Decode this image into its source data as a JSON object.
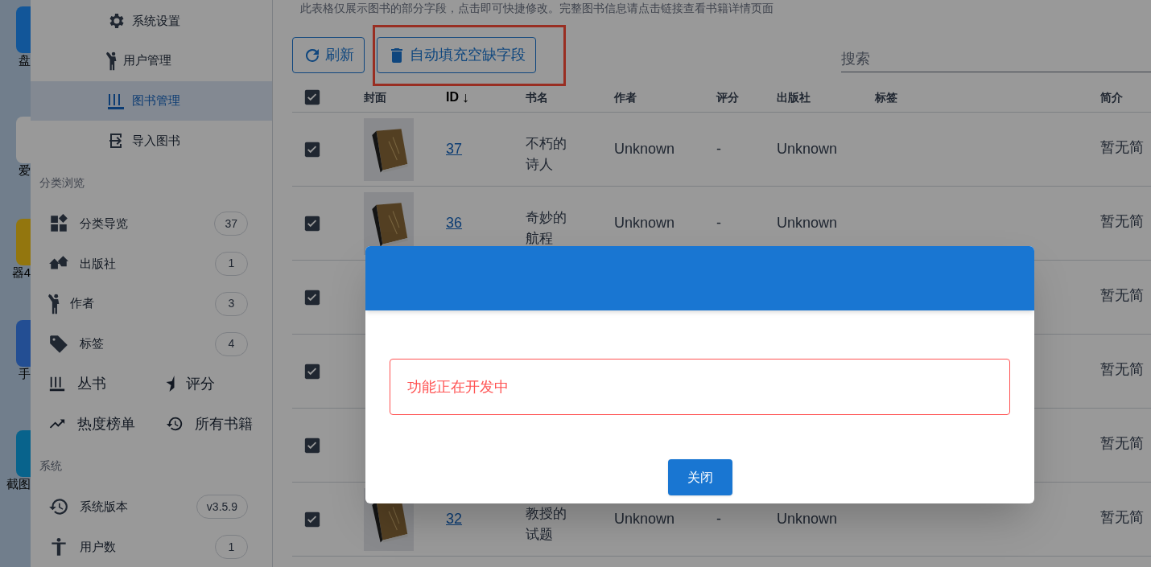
{
  "desktop_icons": [
    {
      "label": "盘"
    },
    {
      "label": "爱"
    },
    {
      "label": "器4"
    },
    {
      "label": "手"
    },
    {
      "label": "截图"
    }
  ],
  "sidebar": {
    "menu": [
      {
        "label": "系统设置",
        "selected": false
      },
      {
        "label": "用户管理",
        "selected": false
      },
      {
        "label": "图书管理",
        "selected": true
      },
      {
        "label": "导入图书",
        "selected": false
      }
    ],
    "browse_title": "分类浏览",
    "browse_items": [
      {
        "label": "分类导览",
        "count": "37"
      },
      {
        "label": "出版社",
        "count": "1"
      },
      {
        "label": "作者",
        "count": "3"
      },
      {
        "label": "标签",
        "count": "4"
      }
    ],
    "quick_links": [
      {
        "label": "丛书"
      },
      {
        "label": "评分"
      },
      {
        "label": "热度榜单"
      },
      {
        "label": "所有书籍"
      }
    ],
    "system_title": "系统",
    "system_items": [
      {
        "label": "系统版本",
        "count": "v3.5.9"
      },
      {
        "label": "用户数",
        "count": "1"
      }
    ]
  },
  "main": {
    "description": "此表格仅展示图书的部分字段，点击即可快捷修改。完整图书信息请点击链接查看书籍详情页面",
    "buttons": [
      {
        "label": "刷新",
        "highlighted": false
      },
      {
        "label": "自动填充空缺字段",
        "highlighted": true
      }
    ],
    "search": {
      "placeholder": "搜索"
    },
    "table": {
      "select_all": {
        "checked": true
      },
      "columns": [
        "封面",
        "ID",
        "书名",
        "作者",
        "评分",
        "出版社",
        "标签",
        "简介"
      ],
      "sort_indicator": "↓",
      "rows": [
        {
          "checked": true,
          "id": "37",
          "title": "不朽的诗人",
          "author": "Unknown",
          "rating": "-",
          "publisher": "Unknown",
          "intro": "暂无简"
        },
        {
          "checked": true,
          "id": "36",
          "title": "奇妙的航程",
          "author": "Unknown",
          "rating": "-",
          "publisher": "Unknown",
          "intro": "暂无简"
        },
        {
          "checked": true,
          "intro": "暂无简"
        },
        {
          "checked": true,
          "intro": "暂无简"
        },
        {
          "checked": true,
          "intro": "暂无简"
        },
        {
          "checked": true,
          "id": "32",
          "title": "教授的试题",
          "author": "Unknown",
          "rating": "-",
          "publisher": "Unknown",
          "intro": "暂无简"
        }
      ]
    }
  },
  "dialog": {
    "message": "功能正在开发中",
    "close_button": "关闭"
  }
}
